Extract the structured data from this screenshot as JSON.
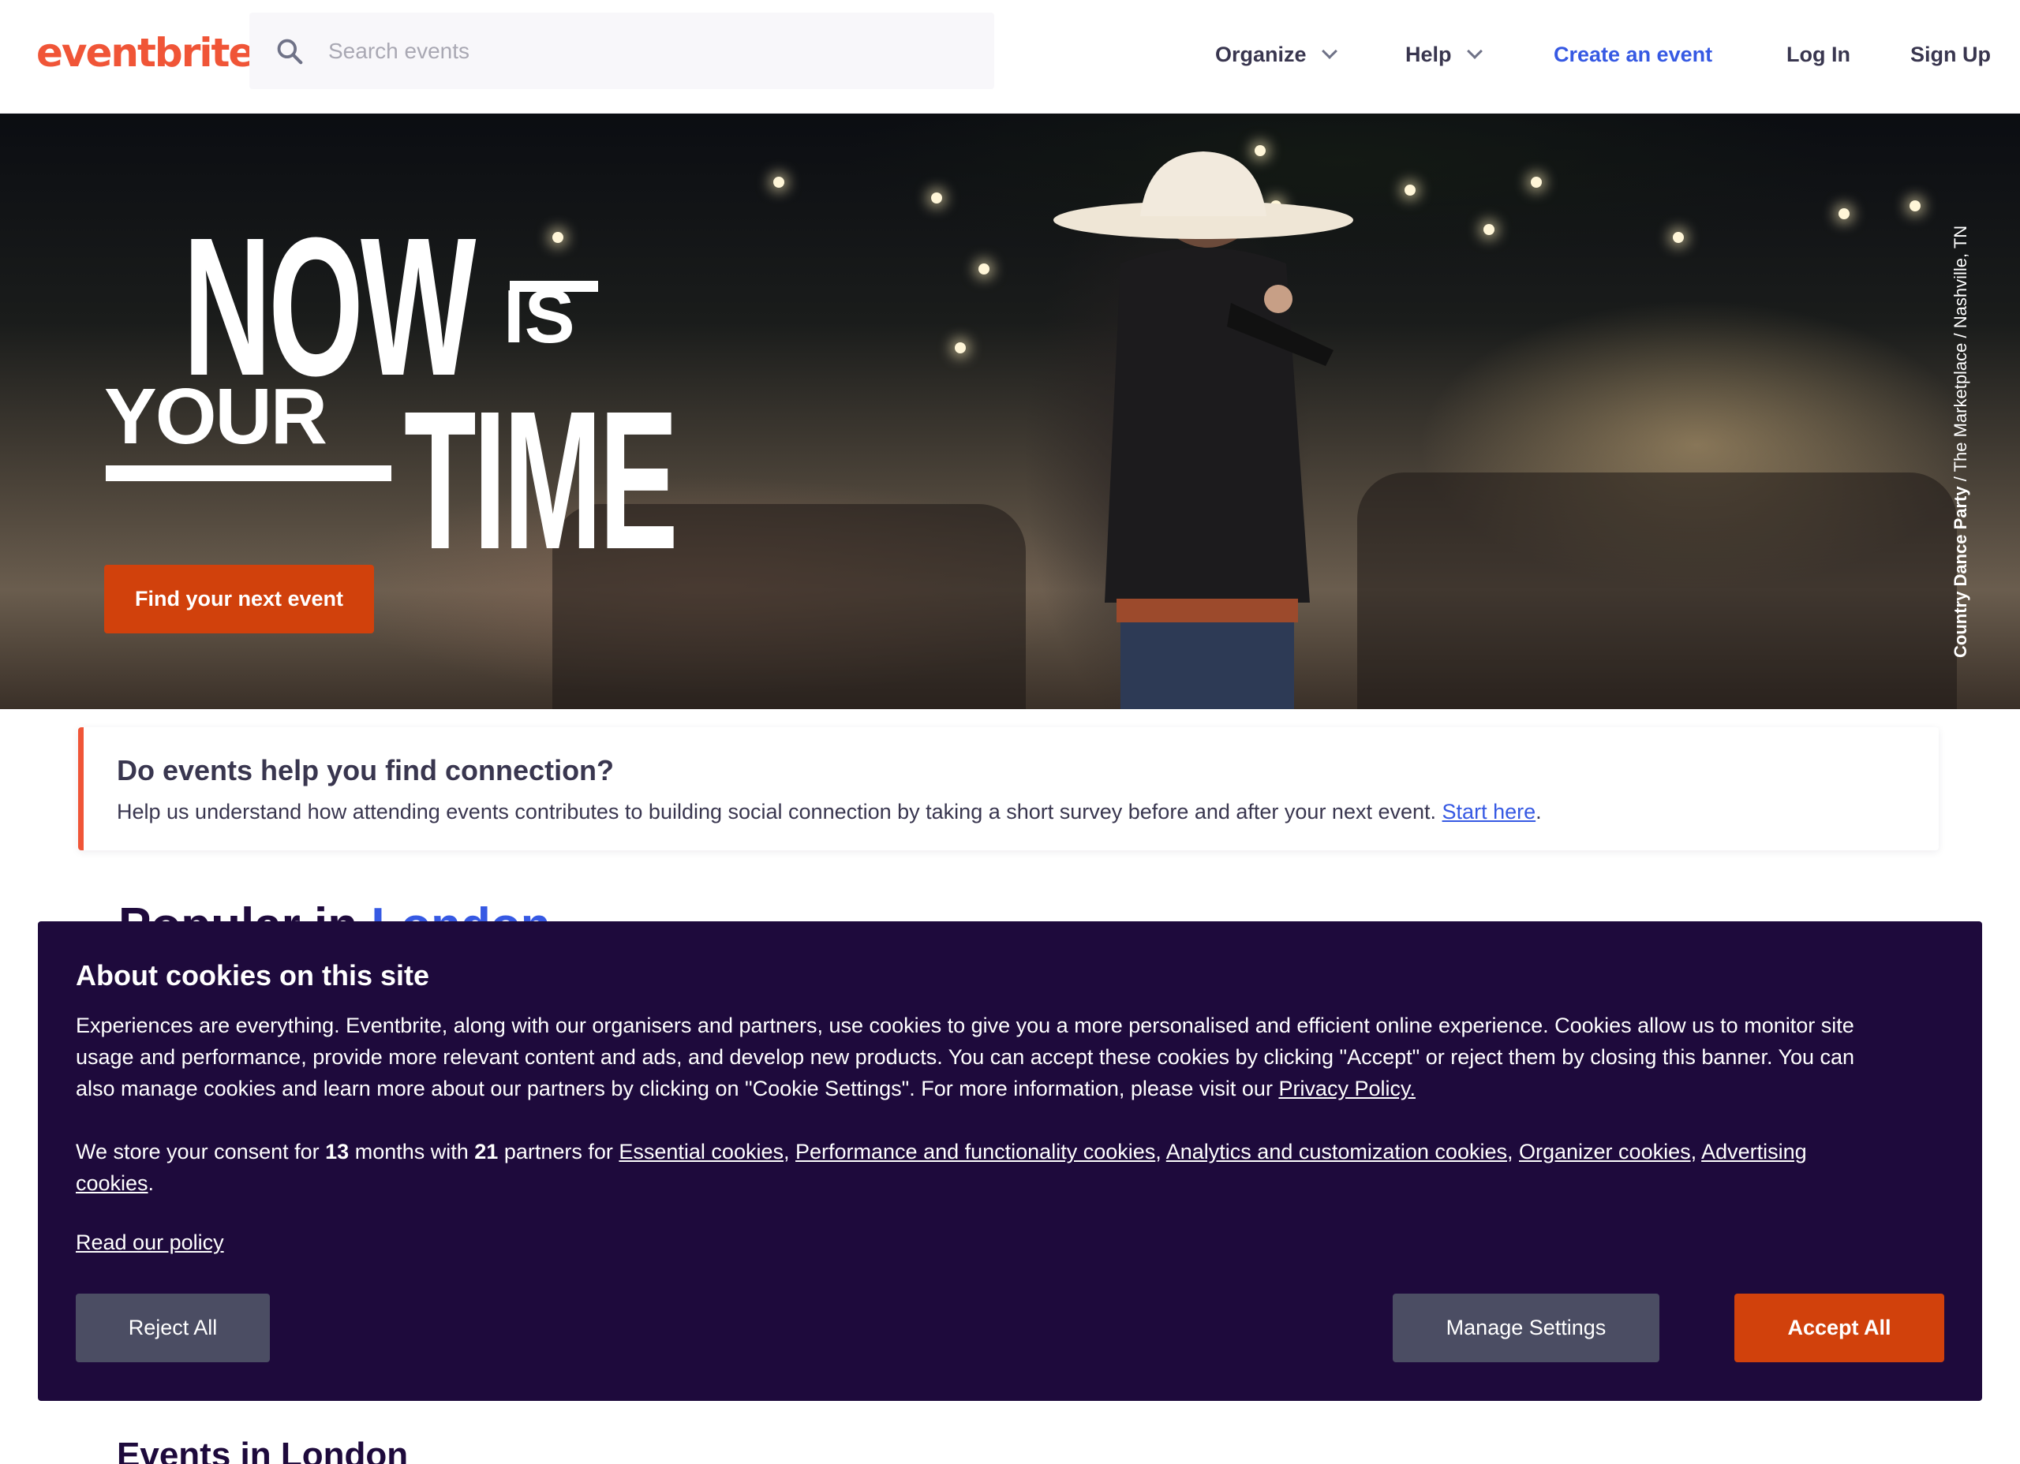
{
  "header": {
    "logo": "eventbrite",
    "search_placeholder": "Search events",
    "nav": {
      "organize": "Organize",
      "help": "Help",
      "create": "Create an event",
      "login": "Log In",
      "signup": "Sign Up"
    }
  },
  "hero": {
    "headline": {
      "now": "NOW",
      "is": "IS",
      "your": "YOUR",
      "time": "TIME"
    },
    "cta": "Find your next event",
    "credit_bold": "Country Dance Party",
    "credit_rest": " / The Marketplace / Nashville, TN"
  },
  "survey": {
    "title": "Do events help you find connection?",
    "text": "Help us understand how attending events contributes to building social connection by taking a short survey before and after your next event.",
    "link": "Start here",
    "period": "."
  },
  "popular": {
    "prefix": "Popular in ",
    "city": "London"
  },
  "cookie": {
    "title": "About cookies on this site",
    "body": "Experiences are everything. Eventbrite, along with our organisers and partners, use cookies to give you a more personalised and efficient online experience. Cookies allow us to monitor site usage and performance, provide more relevant content and ads, and develop new products. You can accept these cookies by clicking \"Accept\" or reject them by closing this banner. You can also manage cookies and learn more about our partners by clicking on \"Cookie Settings\". For more information, please visit our ",
    "privacy_link": "Privacy Policy.",
    "consent_prefix": "We store your consent for ",
    "months": "13",
    "months_text": " months with ",
    "partners": "21",
    "partners_text": " partners for ",
    "categories": [
      "Essential cookies",
      "Performance and functionality cookies",
      "Analytics and customization cookies",
      "Organizer cookies",
      "Advertising cookies"
    ],
    "policy_link": "Read our policy",
    "buttons": {
      "reject": "Reject All",
      "manage": "Manage Settings",
      "accept": "Accept All"
    }
  },
  "events_heading": "Events in London",
  "colors": {
    "brand": "#f05537",
    "cta": "#d1410c",
    "link": "#3659e3",
    "banner_bg": "#1e0a3c",
    "banner_button": "#4b4d63"
  }
}
